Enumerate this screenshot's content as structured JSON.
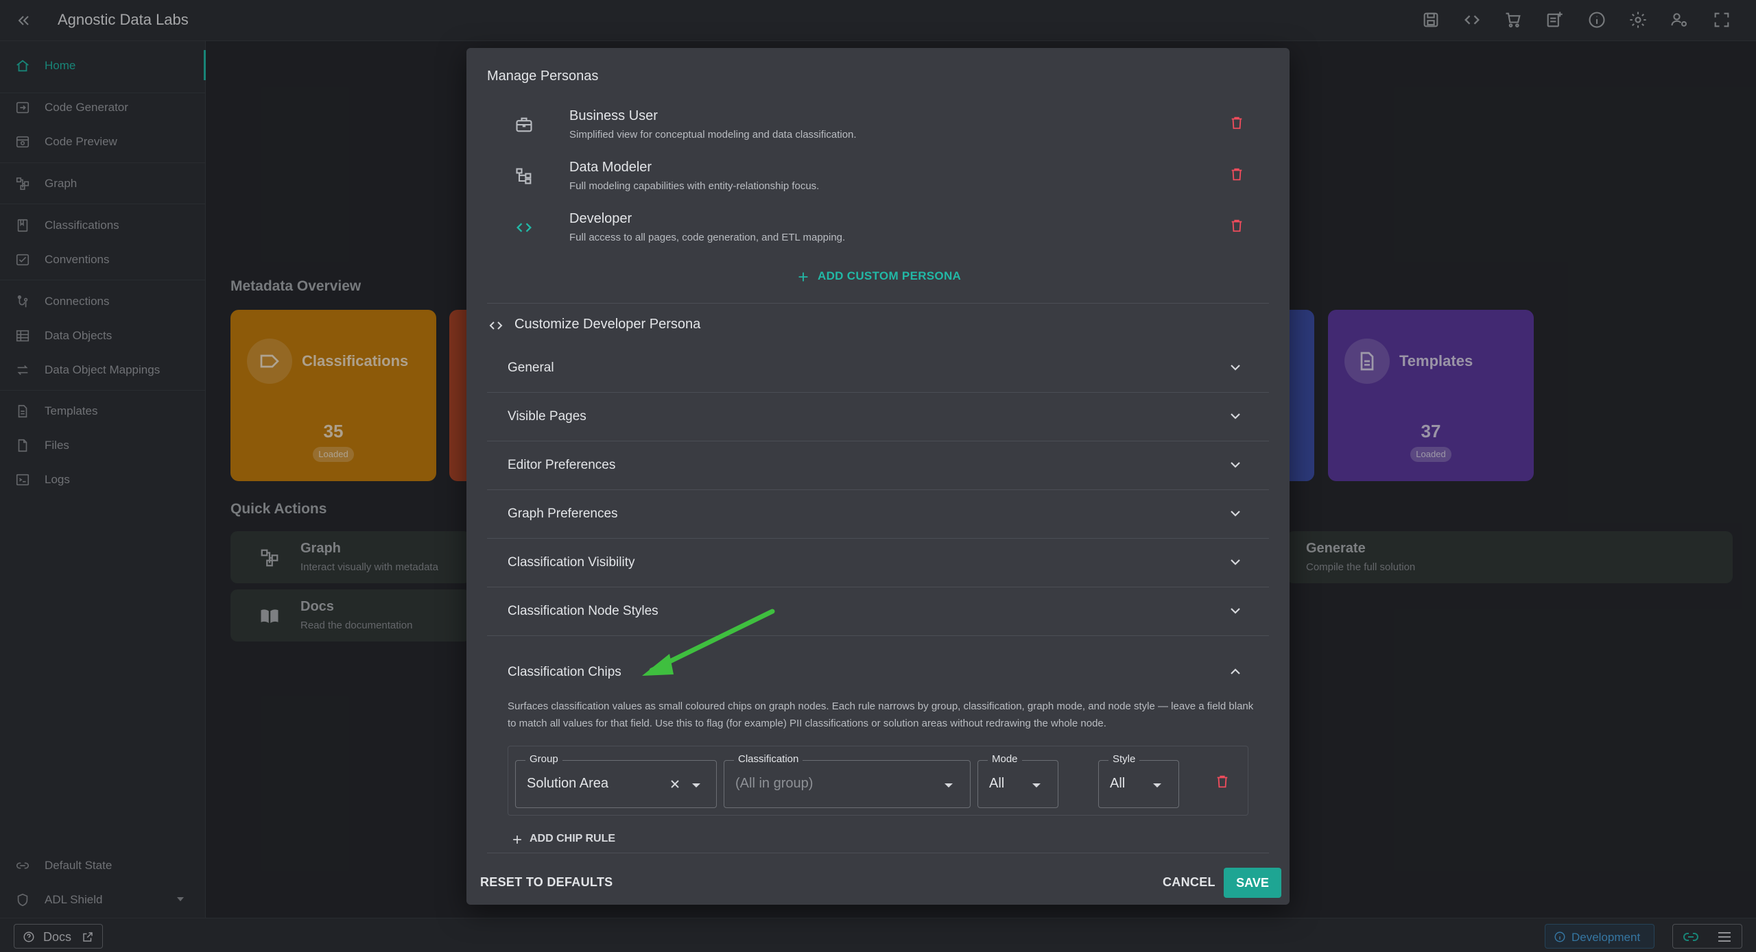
{
  "app": {
    "title": "Agnostic Data Labs"
  },
  "colors": {
    "accent": "#22b8a6",
    "danger": "#ef4c5c",
    "save": "#1ea593",
    "arrow": "#3fbf3f"
  },
  "topbar": {
    "icons": [
      "save-icon",
      "code-icon",
      "cart-icon",
      "note-add-icon",
      "info-icon",
      "settings-icon",
      "manage-accounts-icon",
      "fullscreen-icon"
    ]
  },
  "sidebar": {
    "items": [
      {
        "label": "Home",
        "icon": "home-icon"
      },
      {
        "label": "Code Generator",
        "icon": "code-generator-icon"
      },
      {
        "label": "Code Preview",
        "icon": "code-preview-icon"
      },
      {
        "label": "Graph",
        "icon": "graph-icon"
      },
      {
        "label": "Classifications",
        "icon": "classifications-icon"
      },
      {
        "label": "Conventions",
        "icon": "conventions-icon"
      },
      {
        "label": "Connections",
        "icon": "connections-icon"
      },
      {
        "label": "Data Objects",
        "icon": "data-objects-icon"
      },
      {
        "label": "Data Object Mappings",
        "icon": "mappings-icon"
      },
      {
        "label": "Templates",
        "icon": "templates-icon"
      },
      {
        "label": "Files",
        "icon": "files-icon"
      },
      {
        "label": "Logs",
        "icon": "logs-icon"
      }
    ],
    "default_state": "Default State",
    "shield": "ADL Shield"
  },
  "bottombar": {
    "docs": "Docs",
    "environment": "Development"
  },
  "dashboard": {
    "metadata_title": "Metadata Overview",
    "cards": [
      {
        "name": "Classifications",
        "count": "35",
        "status": "Loaded"
      },
      {
        "name": "Templates",
        "count": "37",
        "status": "Loaded"
      }
    ],
    "quick_actions_title": "Quick Actions",
    "quick_actions": [
      {
        "title": "Graph",
        "subtitle": "Interact visually with metadata"
      },
      {
        "title": "Docs",
        "subtitle": "Read the documentation"
      },
      {
        "title": "Generate",
        "subtitle": "Compile the full solution"
      }
    ]
  },
  "modal": {
    "title": "Manage Personas",
    "personas": [
      {
        "name": "Business User",
        "description": "Simplified view for conceptual modeling and data classification."
      },
      {
        "name": "Data Modeler",
        "description": "Full modeling capabilities with entity-relationship focus."
      },
      {
        "name": "Developer",
        "description": "Full access to all pages, code generation, and ETL mapping."
      }
    ],
    "add_persona": "ADD CUSTOM PERSONA",
    "customize_title": "Customize Developer Persona",
    "sections": [
      "General",
      "Visible Pages",
      "Editor Preferences",
      "Graph Preferences",
      "Classification Visibility",
      "Classification Node Styles"
    ],
    "chips": {
      "title": "Classification Chips",
      "description": "Surfaces classification values as small coloured chips on graph nodes. Each rule narrows by group, classification, graph mode, and node style — leave a field blank to match all values for that field. Use this to flag (for example) PII classifications or solution areas without redrawing the whole node.",
      "rule": {
        "group_label": "Group",
        "group_value": "Solution Area",
        "classification_label": "Classification",
        "classification_placeholder": "(All in group)",
        "mode_label": "Mode",
        "mode_value": "All",
        "style_label": "Style",
        "style_value": "All"
      },
      "add_rule": "ADD CHIP RULE"
    },
    "reset": "RESET TO DEFAULTS",
    "cancel": "CANCEL",
    "save": "SAVE"
  }
}
